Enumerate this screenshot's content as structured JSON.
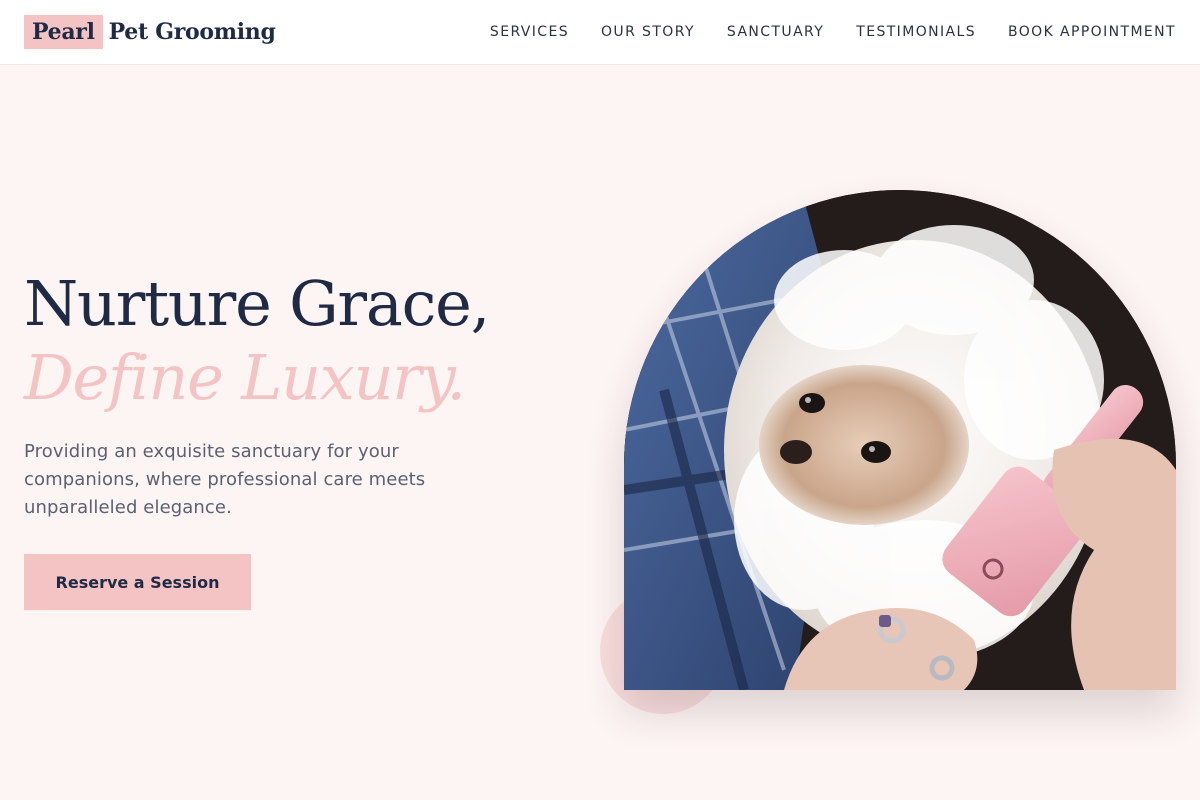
{
  "brand": {
    "mark": "Pearl",
    "name": "Pet Grooming"
  },
  "nav": {
    "items": [
      {
        "label": "SERVICES"
      },
      {
        "label": "OUR STORY"
      },
      {
        "label": "SANCTUARY"
      },
      {
        "label": "TESTIMONIALS"
      },
      {
        "label": "BOOK APPOINTMENT"
      }
    ]
  },
  "hero": {
    "headline_line1": "Nurture Grace,",
    "headline_line2": "Define Luxury.",
    "description": "Providing an exquisite sanctuary for your companions, where professional care meets unparalleled elegance.",
    "cta_label": "Reserve a Session",
    "image_icon": "fluffy-white-dog-being-brushed-photo"
  },
  "colors": {
    "accent_pink": "#f4c4c4",
    "navy": "#1f2a44",
    "background": "#fdf4f4"
  }
}
